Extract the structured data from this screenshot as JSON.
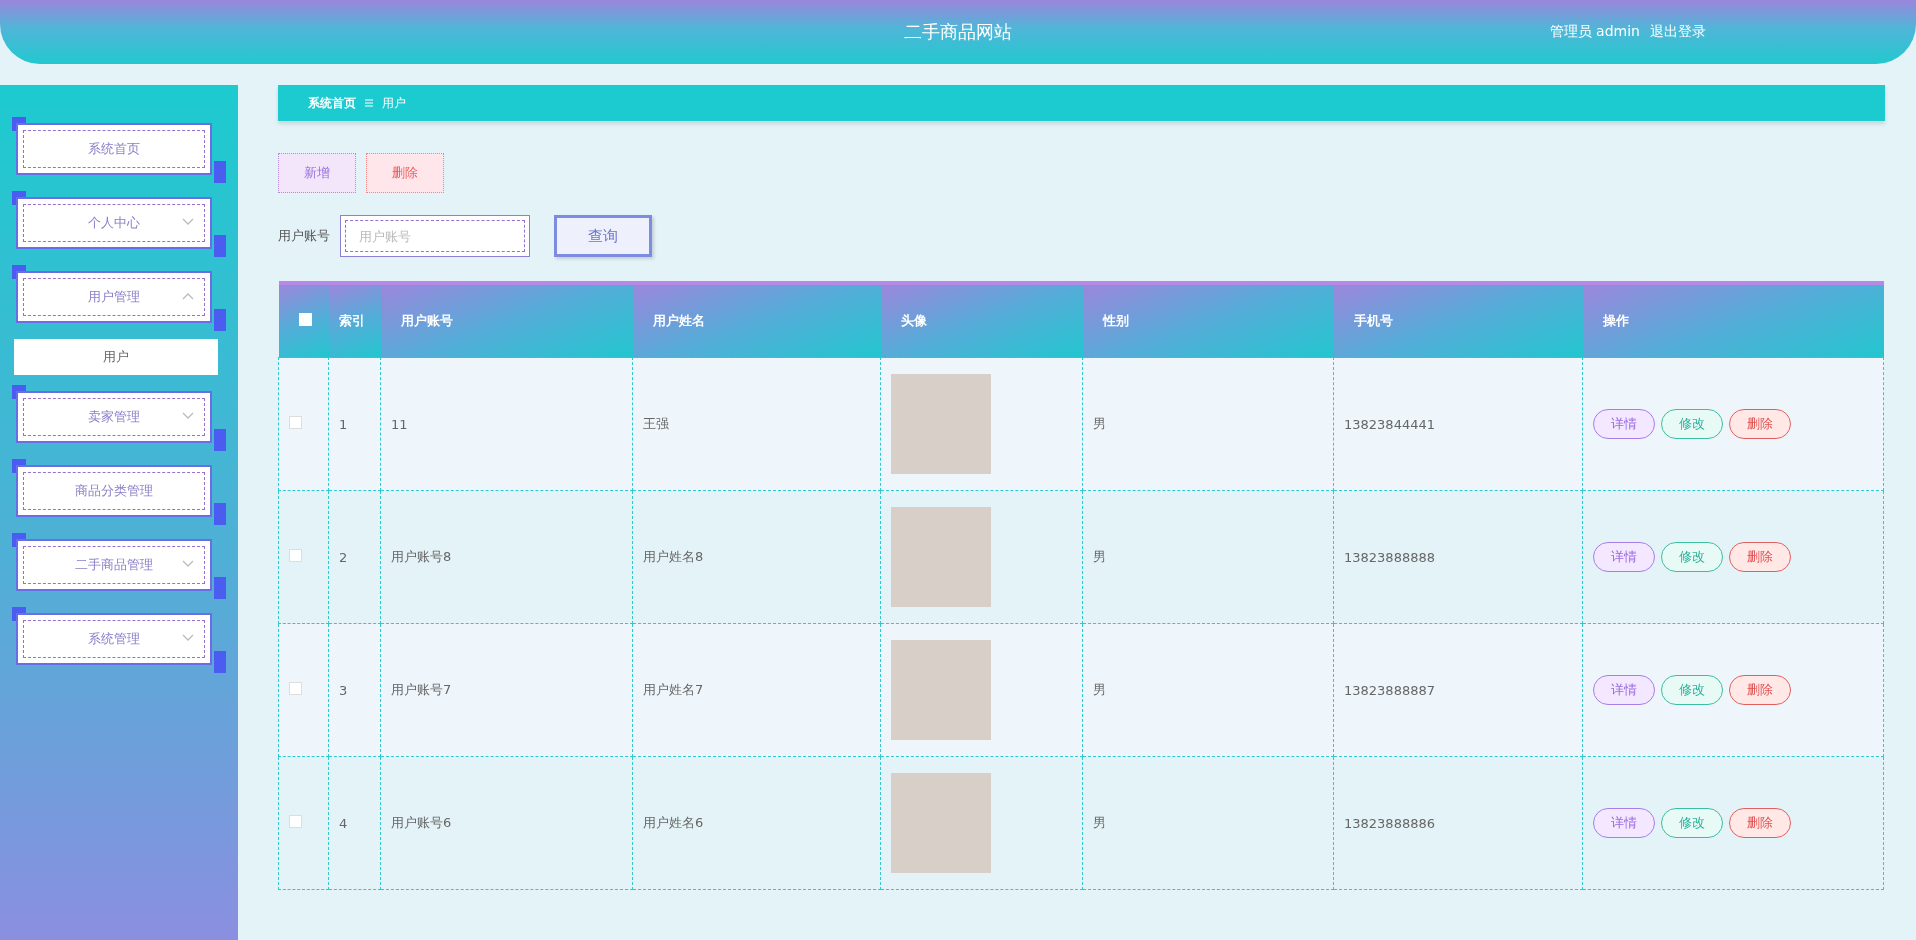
{
  "header": {
    "title": "二手商品网站",
    "user": "管理员 admin",
    "logout": "退出登录"
  },
  "sidebar": {
    "items": [
      {
        "label": "系统首页"
      },
      {
        "label": "个人中心",
        "expanded": false
      },
      {
        "label": "用户管理",
        "expanded": true,
        "children": [
          {
            "label": "用户",
            "selected": true
          }
        ]
      },
      {
        "label": "卖家管理",
        "expanded": false
      },
      {
        "label": "商品分类管理"
      },
      {
        "label": "二手商品管理",
        "expanded": false
      },
      {
        "label": "系统管理",
        "expanded": false
      }
    ]
  },
  "breadcrumb": [
    "系统首页",
    "用户"
  ],
  "toolbar": {
    "buttons": [
      {
        "label": "新增",
        "kind": "add"
      },
      {
        "label": "删除",
        "kind": "delete"
      }
    ]
  },
  "search": {
    "label": "用户账号",
    "placeholder": "用户账号",
    "button": "查询"
  },
  "table": {
    "select_all": {
      "checked": false
    },
    "columns": [
      "索引",
      "用户账号",
      "用户姓名",
      "头像",
      "性别",
      "手机号",
      "操作"
    ],
    "rows": [
      {
        "checked": false,
        "index": "1",
        "account": "11",
        "name": "王强",
        "gender": "男",
        "phone": "13823844441",
        "actions": [
          {
            "label": "详情",
            "kind": "view"
          },
          {
            "label": "修改",
            "kind": "edit"
          },
          {
            "label": "删除",
            "kind": "delete"
          }
        ]
      },
      {
        "checked": false,
        "index": "2",
        "account": "用户账号8",
        "name": "用户姓名8",
        "gender": "男",
        "phone": "13823888888",
        "actions": [
          {
            "label": "详情",
            "kind": "view"
          },
          {
            "label": "修改",
            "kind": "edit"
          },
          {
            "label": "删除",
            "kind": "delete"
          }
        ]
      },
      {
        "checked": false,
        "index": "3",
        "account": "用户账号7",
        "name": "用户姓名7",
        "gender": "男",
        "phone": "13823888887",
        "actions": [
          {
            "label": "详情",
            "kind": "view"
          },
          {
            "label": "修改",
            "kind": "edit"
          },
          {
            "label": "删除",
            "kind": "delete"
          }
        ]
      },
      {
        "checked": false,
        "index": "4",
        "account": "用户账号6",
        "name": "用户姓名6",
        "gender": "男",
        "phone": "13823888886",
        "actions": [
          {
            "label": "详情",
            "kind": "view"
          },
          {
            "label": "修改",
            "kind": "edit"
          },
          {
            "label": "删除",
            "kind": "delete"
          }
        ]
      }
    ]
  }
}
